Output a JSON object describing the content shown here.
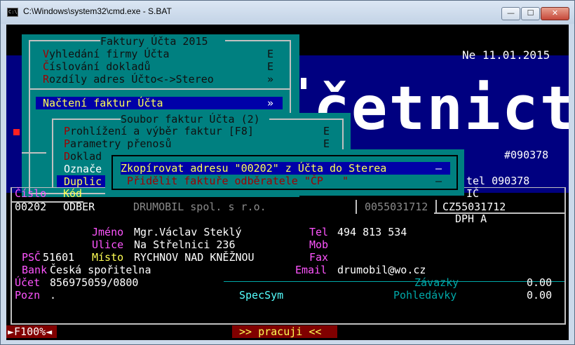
{
  "window": {
    "title": "C:\\Windows\\system32\\cmd.exe - S.BAT",
    "icon_label": "C:\\",
    "min_glyph": "—",
    "max_glyph": "☐",
    "close_glyph": "✕"
  },
  "banner": {
    "date": "Ne 11.01.2015",
    "logo": "četnictví",
    "code": "#090378",
    "tel": "tel 090378",
    "ic": "IČ"
  },
  "menu_faktury": {
    "title": "Faktury Účta 2015",
    "items": [
      {
        "hot": "V",
        "rest": "yhledání firmy Účta",
        "key": "E"
      },
      {
        "hot": "Č",
        "rest": "íslování dokladů",
        "key": "E"
      },
      {
        "hot": "R",
        "rest": "ozdíly adres Účto<->Stereo",
        "key": "»"
      },
      {
        "hot": "N",
        "rest": "ačtení faktur Účta",
        "key": "»"
      }
    ]
  },
  "menu_soubor": {
    "title": "Soubor faktur Účta (2)",
    "items": [
      {
        "hot": "P",
        "rest": "rohlížení a výběr faktur [F8]",
        "key": "E"
      },
      {
        "hot": "P",
        "rest": "arametry přenosů",
        "key": "E"
      },
      {
        "hot": "D",
        "rest": "oklad",
        "key": ""
      },
      {
        "hot": "O",
        "rest": "znače",
        "key": ""
      },
      {
        "hot": "D",
        "rest": "uplic",
        "key": ""
      }
    ]
  },
  "menu_action": {
    "items": [
      {
        "text": "Zkopírovat adresu \"00202\" z Účta do Sterea",
        "key": "–"
      },
      {
        "text": "Přidělit faktuře odběratele \"ČP   \"",
        "key": "–"
      }
    ]
  },
  "record": {
    "cislo_label": "Číslo",
    "kod_label": "Kód",
    "cislo": "00202",
    "kod": "ODBER",
    "firma": "DRUMOBIL spol. s r.o.",
    "ico": "0055031712",
    "dic": "CZ55031712",
    "dph_label": "DPH A",
    "jmeno_label": "Jméno",
    "jmeno": "Mgr.Václav Steklý",
    "ulice_label": "Ulice",
    "ulice": "Na Střelnici 236",
    "psc_label": "PSČ",
    "psc": "51601",
    "misto_label": "Místo",
    "misto": "RYCHNOV NAD KNĚŽNOU",
    "bank_label": "Bank",
    "bank": "Česká spořitelna",
    "ucet_label": "Účet",
    "ucet": "856975059/0800",
    "pozn_label": "Pozn",
    "pozn": ".",
    "tel_label": "Tel",
    "tel": "494 813 534",
    "mob_label": "Mob",
    "fax_label": "Fax",
    "email_label": "Email",
    "email": "drumobil@wo.cz",
    "specsym_label": "SpecSym",
    "zavazky_label": "Závazky",
    "zavazky": "0.00",
    "pohledavky_label": "Pohledávky",
    "pohledavky": "0.00"
  },
  "status": {
    "f100": "►F100%◄",
    "working": ">> pracuji <<"
  },
  "colors": {
    "menu_bg": "#008080",
    "highlight": "#0000a8",
    "banner_bg": "#000080",
    "status_red": "#800000"
  }
}
